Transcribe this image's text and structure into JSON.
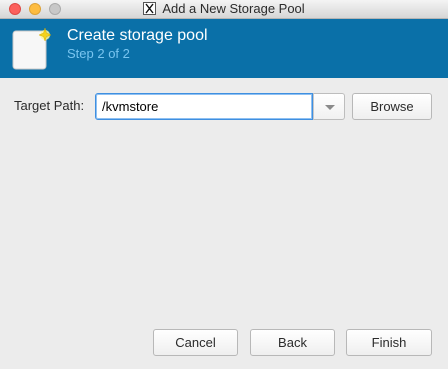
{
  "window": {
    "title": "Add a New Storage Pool",
    "app_icon": "x11-icon"
  },
  "banner": {
    "title": "Create storage pool",
    "subtitle": "Step 2 of 2",
    "icon": "new-document-icon",
    "background_color": "#0a70a8",
    "subtitle_color": "#79c5f0"
  },
  "form": {
    "target_path_label": "Target Path:",
    "target_path_value": "/kvmstore",
    "browse_label": "Browse"
  },
  "footer": {
    "cancel_label": "Cancel",
    "back_label": "Back",
    "finish_label": "Finish"
  }
}
